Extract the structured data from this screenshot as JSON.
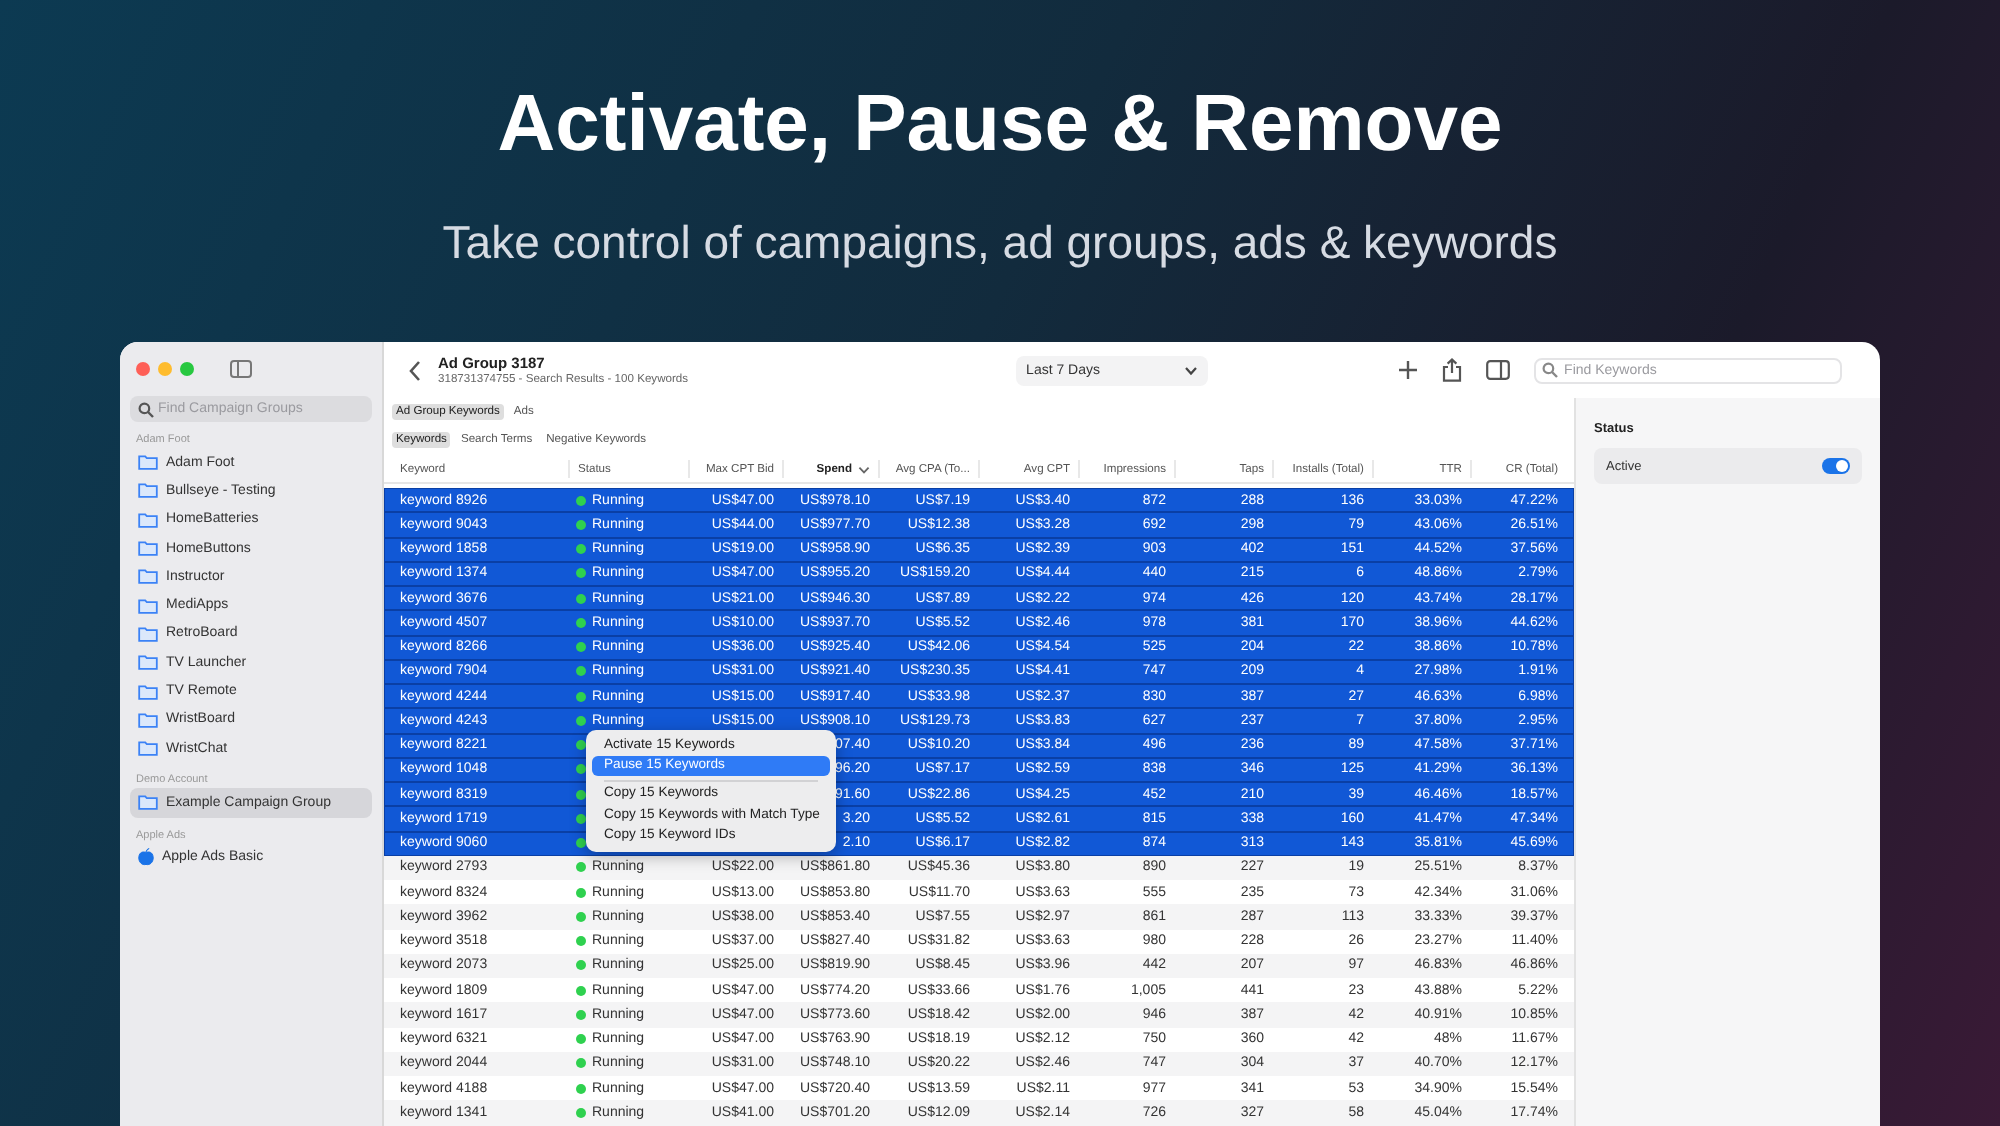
{
  "hero": {
    "title": "Activate, Pause & Remove",
    "subtitle": "Take control of campaigns, ad groups, ads & keywords"
  },
  "sidebar": {
    "search": {
      "placeholder": "Find Campaign Groups"
    },
    "sections": [
      {
        "title": "Adam Foot",
        "items": [
          {
            "label": "Adam Foot",
            "kind": "folder",
            "selected": false
          },
          {
            "label": "Bullseye - Testing",
            "kind": "folder",
            "selected": false
          },
          {
            "label": "HomeBatteries",
            "kind": "folder",
            "selected": false
          },
          {
            "label": "HomeButtons",
            "kind": "folder",
            "selected": false
          },
          {
            "label": "Instructor",
            "kind": "folder",
            "selected": false
          },
          {
            "label": "MediApps",
            "kind": "folder",
            "selected": false
          },
          {
            "label": "RetroBoard",
            "kind": "folder",
            "selected": false
          },
          {
            "label": "TV Launcher",
            "kind": "folder",
            "selected": false
          },
          {
            "label": "TV Remote",
            "kind": "folder",
            "selected": false
          },
          {
            "label": "WristBoard",
            "kind": "folder",
            "selected": false
          },
          {
            "label": "WristChat",
            "kind": "folder",
            "selected": false
          }
        ]
      },
      {
        "title": "Demo Account",
        "items": [
          {
            "label": "Example Campaign Group",
            "kind": "folder",
            "selected": true
          }
        ]
      },
      {
        "title": "Apple Ads",
        "items": [
          {
            "label": "Apple Ads Basic",
            "kind": "app",
            "selected": false
          }
        ]
      }
    ]
  },
  "toolbar": {
    "title": "Ad Group 3187",
    "subtitle": "318731374755 - Search Results - 100 Keywords",
    "date_range": "Last 7 Days",
    "search": {
      "placeholder": "Find Keywords"
    }
  },
  "tabs": [
    {
      "label": "Ad Group Keywords",
      "selected": true
    },
    {
      "label": "Ads",
      "selected": false
    }
  ],
  "subtabs": [
    {
      "label": "Keywords",
      "selected": true
    },
    {
      "label": "Search Terms",
      "selected": false
    },
    {
      "label": "Negative Keywords",
      "selected": false
    }
  ],
  "table": {
    "columns": [
      {
        "label": "Keyword",
        "sorted": false
      },
      {
        "label": "Status",
        "sorted": false
      },
      {
        "label": "Max CPT Bid",
        "sorted": false
      },
      {
        "label": "Spend",
        "sorted": true
      },
      {
        "label": "Avg CPA (To...",
        "sorted": false
      },
      {
        "label": "Avg CPT",
        "sorted": false
      },
      {
        "label": "Impressions",
        "sorted": false
      },
      {
        "label": "Taps",
        "sorted": false
      },
      {
        "label": "Installs (Total)",
        "sorted": false
      },
      {
        "label": "TTR",
        "sorted": false
      },
      {
        "label": "CR (Total)",
        "sorted": false
      }
    ],
    "rows": [
      {
        "selected": true,
        "cells": [
          "keyword 8926",
          "Running",
          "US$47.00",
          "US$978.10",
          "US$7.19",
          "US$3.40",
          "872",
          "288",
          "136",
          "33.03%",
          "47.22%"
        ]
      },
      {
        "selected": true,
        "cells": [
          "keyword 9043",
          "Running",
          "US$44.00",
          "US$977.70",
          "US$12.38",
          "US$3.28",
          "692",
          "298",
          "79",
          "43.06%",
          "26.51%"
        ]
      },
      {
        "selected": true,
        "cells": [
          "keyword 1858",
          "Running",
          "US$19.00",
          "US$958.90",
          "US$6.35",
          "US$2.39",
          "903",
          "402",
          "151",
          "44.52%",
          "37.56%"
        ]
      },
      {
        "selected": true,
        "cells": [
          "keyword 1374",
          "Running",
          "US$47.00",
          "US$955.20",
          "US$159.20",
          "US$4.44",
          "440",
          "215",
          "6",
          "48.86%",
          "2.79%"
        ]
      },
      {
        "selected": true,
        "cells": [
          "keyword 3676",
          "Running",
          "US$21.00",
          "US$946.30",
          "US$7.89",
          "US$2.22",
          "974",
          "426",
          "120",
          "43.74%",
          "28.17%"
        ]
      },
      {
        "selected": true,
        "cells": [
          "keyword 4507",
          "Running",
          "US$10.00",
          "US$937.70",
          "US$5.52",
          "US$2.46",
          "978",
          "381",
          "170",
          "38.96%",
          "44.62%"
        ]
      },
      {
        "selected": true,
        "cells": [
          "keyword 8266",
          "Running",
          "US$36.00",
          "US$925.40",
          "US$42.06",
          "US$4.54",
          "525",
          "204",
          "22",
          "38.86%",
          "10.78%"
        ]
      },
      {
        "selected": true,
        "cells": [
          "keyword 7904",
          "Running",
          "US$31.00",
          "US$921.40",
          "US$230.35",
          "US$4.41",
          "747",
          "209",
          "4",
          "27.98%",
          "1.91%"
        ]
      },
      {
        "selected": true,
        "cells": [
          "keyword 4244",
          "Running",
          "US$15.00",
          "US$917.40",
          "US$33.98",
          "US$2.37",
          "830",
          "387",
          "27",
          "46.63%",
          "6.98%"
        ]
      },
      {
        "selected": true,
        "cells": [
          "keyword 4243",
          "Running",
          "US$15.00",
          "US$908.10",
          "US$129.73",
          "US$3.83",
          "627",
          "237",
          "7",
          "37.80%",
          "2.95%"
        ]
      },
      {
        "selected": true,
        "cells": [
          "keyword 8221",
          "",
          "",
          "07.40",
          "US$10.20",
          "US$3.84",
          "496",
          "236",
          "89",
          "47.58%",
          "37.71%"
        ]
      },
      {
        "selected": true,
        "cells": [
          "keyword 1048",
          "",
          "",
          "96.20",
          "US$7.17",
          "US$2.59",
          "838",
          "346",
          "125",
          "41.29%",
          "36.13%"
        ]
      },
      {
        "selected": true,
        "cells": [
          "keyword 8319",
          "",
          "",
          "91.60",
          "US$22.86",
          "US$4.25",
          "452",
          "210",
          "39",
          "46.46%",
          "18.57%"
        ]
      },
      {
        "selected": true,
        "cells": [
          "keyword 1719",
          "",
          "",
          "3.20",
          "US$5.52",
          "US$2.61",
          "815",
          "338",
          "160",
          "41.47%",
          "47.34%"
        ]
      },
      {
        "selected": true,
        "cells": [
          "keyword 9060",
          "",
          "",
          "2.10",
          "US$6.17",
          "US$2.82",
          "874",
          "313",
          "143",
          "35.81%",
          "45.69%"
        ]
      },
      {
        "selected": false,
        "cells": [
          "keyword 2793",
          "Running",
          "US$22.00",
          "US$861.80",
          "US$45.36",
          "US$3.80",
          "890",
          "227",
          "19",
          "25.51%",
          "8.37%"
        ]
      },
      {
        "selected": false,
        "cells": [
          "keyword 8324",
          "Running",
          "US$13.00",
          "US$853.80",
          "US$11.70",
          "US$3.63",
          "555",
          "235",
          "73",
          "42.34%",
          "31.06%"
        ]
      },
      {
        "selected": false,
        "cells": [
          "keyword 3962",
          "Running",
          "US$38.00",
          "US$853.40",
          "US$7.55",
          "US$2.97",
          "861",
          "287",
          "113",
          "33.33%",
          "39.37%"
        ]
      },
      {
        "selected": false,
        "cells": [
          "keyword 3518",
          "Running",
          "US$37.00",
          "US$827.40",
          "US$31.82",
          "US$3.63",
          "980",
          "228",
          "26",
          "23.27%",
          "11.40%"
        ]
      },
      {
        "selected": false,
        "cells": [
          "keyword 2073",
          "Running",
          "US$25.00",
          "US$819.90",
          "US$8.45",
          "US$3.96",
          "442",
          "207",
          "97",
          "46.83%",
          "46.86%"
        ]
      },
      {
        "selected": false,
        "cells": [
          "keyword 1809",
          "Running",
          "US$47.00",
          "US$774.20",
          "US$33.66",
          "US$1.76",
          "1,005",
          "441",
          "23",
          "43.88%",
          "5.22%"
        ]
      },
      {
        "selected": false,
        "cells": [
          "keyword 1617",
          "Running",
          "US$47.00",
          "US$773.60",
          "US$18.42",
          "US$2.00",
          "946",
          "387",
          "42",
          "40.91%",
          "10.85%"
        ]
      },
      {
        "selected": false,
        "cells": [
          "keyword 6321",
          "Running",
          "US$47.00",
          "US$763.90",
          "US$18.19",
          "US$2.12",
          "750",
          "360",
          "42",
          "48%",
          "11.67%"
        ]
      },
      {
        "selected": false,
        "cells": [
          "keyword 2044",
          "Running",
          "US$31.00",
          "US$748.10",
          "US$20.22",
          "US$2.46",
          "747",
          "304",
          "37",
          "40.70%",
          "12.17%"
        ]
      },
      {
        "selected": false,
        "cells": [
          "keyword 4188",
          "Running",
          "US$47.00",
          "US$720.40",
          "US$13.59",
          "US$2.11",
          "977",
          "341",
          "53",
          "34.90%",
          "15.54%"
        ]
      },
      {
        "selected": false,
        "cells": [
          "keyword 1341",
          "Running",
          "US$41.00",
          "US$701.20",
          "US$12.09",
          "US$2.14",
          "726",
          "327",
          "58",
          "45.04%",
          "17.74%"
        ]
      }
    ]
  },
  "context_menu": [
    {
      "kind": "action",
      "label": "Activate 15 Keywords",
      "selected": false
    },
    {
      "kind": "action",
      "label": "Pause 15 Keywords",
      "selected": true
    },
    {
      "kind": "separator"
    },
    {
      "kind": "action",
      "label": "Copy 15 Keywords",
      "selected": false
    },
    {
      "kind": "action",
      "label": "Copy 15 Keywords with Match Type",
      "selected": false
    },
    {
      "kind": "action",
      "label": "Copy 15 Keyword IDs",
      "selected": false
    }
  ],
  "inspector": {
    "title": "Status",
    "toggle": {
      "label": "Active",
      "on": true
    }
  }
}
